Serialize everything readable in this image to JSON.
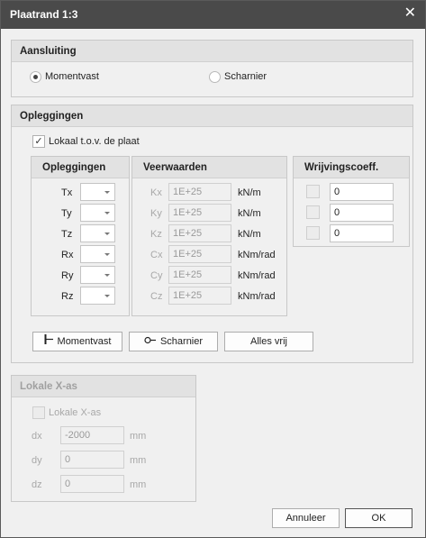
{
  "window": {
    "title": "Plaatrand 1:3",
    "close_glyph": "✕"
  },
  "aansluiting": {
    "header": "Aansluiting",
    "options": [
      {
        "label": "Momentvast",
        "checked": true
      },
      {
        "label": "Scharnier",
        "checked": false
      }
    ]
  },
  "opleggingen": {
    "header": "Opleggingen",
    "lokaal_label": "Lokaal t.o.v. de plaat",
    "lokaal_checked": true,
    "check_glyph": "✓",
    "supports": {
      "header": "Opleggingen",
      "rows": [
        "Tx",
        "Ty",
        "Tz",
        "Rx",
        "Ry",
        "Rz"
      ]
    },
    "springs": {
      "header": "Veerwaarden",
      "rows": [
        {
          "label": "Kx",
          "value": "1E+25",
          "unit": "kN/m"
        },
        {
          "label": "Ky",
          "value": "1E+25",
          "unit": "kN/m"
        },
        {
          "label": "Kz",
          "value": "1E+25",
          "unit": "kN/m"
        },
        {
          "label": "Cx",
          "value": "1E+25",
          "unit": "kNm/rad"
        },
        {
          "label": "Cy",
          "value": "1E+25",
          "unit": "kNm/rad"
        },
        {
          "label": "Cz",
          "value": "1E+25",
          "unit": "kNm/rad"
        }
      ]
    },
    "friction": {
      "header": "Wrijvingscoeff.",
      "rows": [
        "0",
        "0",
        "0"
      ]
    },
    "buttons": {
      "momentvast": "Momentvast",
      "scharnier": "Scharnier",
      "alles_vrij": "Alles vrij"
    }
  },
  "lokale_x_as": {
    "header": "Lokale X-as",
    "checkbox_label": "Lokale X-as",
    "rows": [
      {
        "label": "dx",
        "value": "-2000",
        "unit": "mm"
      },
      {
        "label": "dy",
        "value": "0",
        "unit": "mm"
      },
      {
        "label": "dz",
        "value": "0",
        "unit": "mm"
      }
    ]
  },
  "footer": {
    "cancel": "Annuleer",
    "ok": "OK"
  },
  "icons": {
    "close": "close-icon",
    "check": "checkmark-icon",
    "fixed": "fixed-support-icon",
    "hinge": "hinge-icon",
    "dropdown": "chevron-down-icon"
  }
}
